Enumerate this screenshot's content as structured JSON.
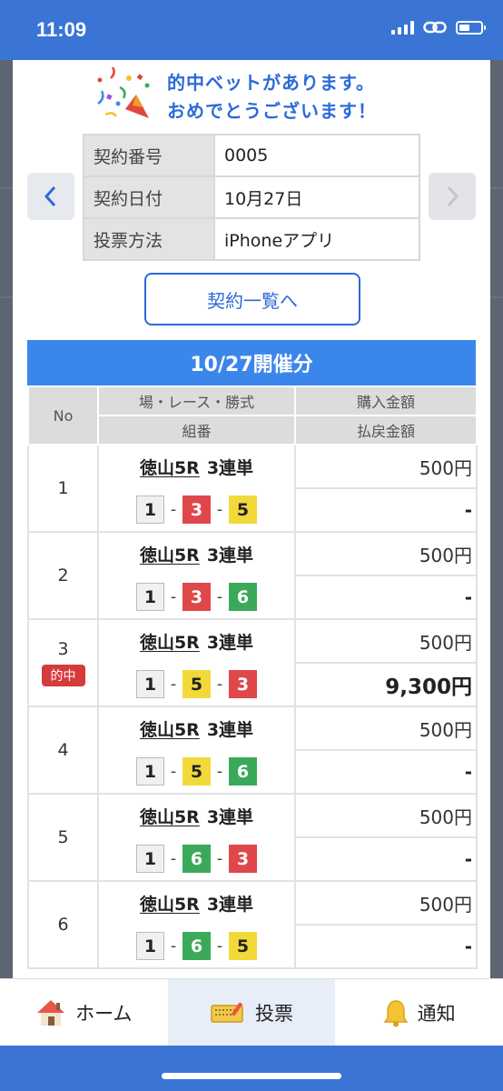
{
  "status": {
    "time": "11:09"
  },
  "congrats": {
    "line1": "的中ベットがあります。",
    "line2": "おめでとうございます！"
  },
  "contract": {
    "rows": [
      {
        "label": "契約番号",
        "value": "0005"
      },
      {
        "label": "契約日付",
        "value": "10月27日"
      },
      {
        "label": "投票方法",
        "value": "iPhoneアプリ"
      }
    ]
  },
  "list_button": "契約一覧へ",
  "session_title": "10/27開催分",
  "table": {
    "h_no": "No",
    "h_race": "場・レース・勝式",
    "h_combo": "組番",
    "h_amount": "購入金額",
    "h_payout": "払戻金額"
  },
  "bets": [
    {
      "no": "1",
      "venue": "徳山5R",
      "type": "3連単",
      "c1": "1",
      "c2": "3",
      "c3": "5",
      "amount": "500円",
      "payout": "-",
      "hit": ""
    },
    {
      "no": "2",
      "venue": "徳山5R",
      "type": "3連単",
      "c1": "1",
      "c2": "3",
      "c3": "6",
      "amount": "500円",
      "payout": "-",
      "hit": ""
    },
    {
      "no": "3",
      "venue": "徳山5R",
      "type": "3連単",
      "c1": "1",
      "c2": "5",
      "c3": "3",
      "amount": "500円",
      "payout": "9,300円",
      "hit": "的中"
    },
    {
      "no": "4",
      "venue": "徳山5R",
      "type": "3連単",
      "c1": "1",
      "c2": "5",
      "c3": "6",
      "amount": "500円",
      "payout": "-",
      "hit": ""
    },
    {
      "no": "5",
      "venue": "徳山5R",
      "type": "3連単",
      "c1": "1",
      "c2": "6",
      "c3": "3",
      "amount": "500円",
      "payout": "-",
      "hit": ""
    },
    {
      "no": "6",
      "venue": "徳山5R",
      "type": "3連単",
      "c1": "1",
      "c2": "6",
      "c3": "5",
      "amount": "500円",
      "payout": "-",
      "hit": ""
    }
  ],
  "boat_colors": {
    "1": "#f0f0f0",
    "3": "#e0474a",
    "5": "#f2d93a",
    "6": "#3aaa5a"
  },
  "tabs": [
    {
      "label": "ホーム",
      "icon": "home-icon"
    },
    {
      "label": "投票",
      "icon": "ticket-icon"
    },
    {
      "label": "通知",
      "icon": "bell-icon"
    }
  ],
  "colors": {
    "accent": "#3a75d6",
    "header": "#3b86ea",
    "hit_badge": "#d53b3b"
  }
}
